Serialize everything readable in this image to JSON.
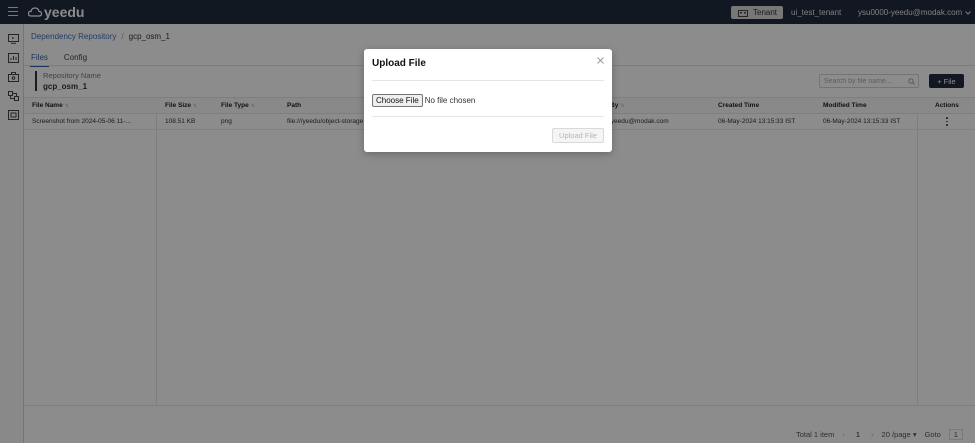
{
  "app": {
    "logo_text": "yeedu"
  },
  "header": {
    "tenant_button_label": "Tenant",
    "tenant_name": "ui_test_tenant",
    "user_email": "ysu0000-yeedu@modak.com"
  },
  "breadcrumb": {
    "parent": "Dependency Repository",
    "separator": "/",
    "current": "gcp_osm_1"
  },
  "tabs": [
    {
      "label": "Files"
    },
    {
      "label": "Config"
    }
  ],
  "repository": {
    "label": "Repository Name",
    "value": "gcp_osm_1"
  },
  "toolbar": {
    "search_placeholder": "Search by file name...",
    "add_file_label": "File"
  },
  "table": {
    "columns": [
      "File Name",
      "File Size",
      "File Type",
      "Path",
      "Created By",
      "Created Time",
      "Modified Time",
      "Actions"
    ],
    "rows": [
      {
        "file_name": "Screenshot from 2024-05-06 11-...",
        "file_size": "108.51 KB",
        "file_type": "png",
        "path": "file:///yeedu/object-storage",
        "created_by": "ysu0000-yeedu@modak.com",
        "created_time": "06-May-2024 13:15:33 IST",
        "modified_time": "06-May-2024 13:15:33 IST"
      }
    ]
  },
  "pagination": {
    "total": "Total 1 item",
    "prev": "‹",
    "page": "1",
    "next": "›",
    "page_size": "20 /page",
    "goto_label": "Goto",
    "goto_value": "1"
  },
  "modal": {
    "title": "Upload File",
    "choose_file_label": "Choose File",
    "no_file_text": "No file chosen",
    "upload_button_label": "Upload File"
  }
}
